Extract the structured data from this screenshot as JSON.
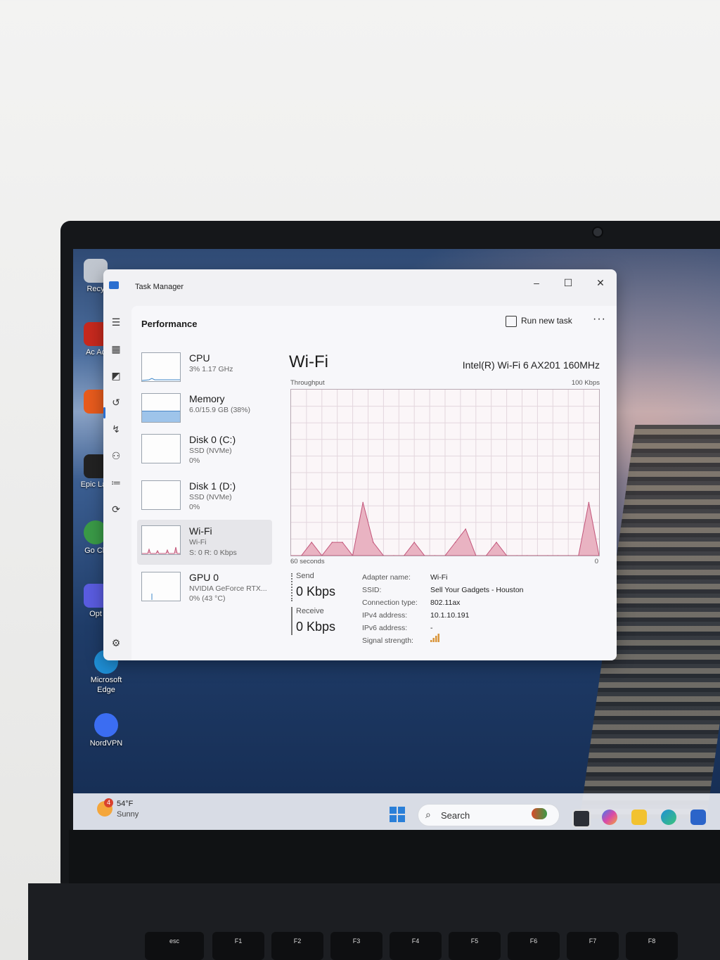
{
  "window": {
    "title": "Task Manager",
    "controls": {
      "minimize": "–",
      "maximize": "☐",
      "close": "✕"
    }
  },
  "page": {
    "heading": "Performance",
    "run_new_task": "Run new task",
    "more": "···"
  },
  "nav_icons": [
    "menu-icon",
    "processes-icon",
    "performance-icon",
    "app-history-icon",
    "startup-apps-icon",
    "users-icon",
    "details-icon",
    "services-icon",
    "settings-icon"
  ],
  "resources": [
    {
      "name": "CPU",
      "line1": "3%  1.17 GHz",
      "line2": ""
    },
    {
      "name": "Memory",
      "line1": "6.0/15.9 GB (38%)",
      "line2": ""
    },
    {
      "name": "Disk 0 (C:)",
      "line1": "SSD (NVMe)",
      "line2": "0%"
    },
    {
      "name": "Disk 1 (D:)",
      "line1": "SSD (NVMe)",
      "line2": "0%"
    },
    {
      "name": "Wi-Fi",
      "line1": "Wi-Fi",
      "line2": "S: 0  R: 0 Kbps"
    },
    {
      "name": "GPU 0",
      "line1": "NVIDIA GeForce RTX...",
      "line2": "0%  (43 °C)"
    }
  ],
  "selected_resource": "Wi-Fi",
  "detail": {
    "title": "Wi-Fi",
    "adapter_model": "Intel(R) Wi-Fi 6 AX201 160MHz",
    "throughput_label": "Throughput",
    "max_label": "100 Kbps",
    "time_label": "60 seconds",
    "zero_label": "0",
    "send_label": "Send",
    "send_value": "0 Kbps",
    "receive_label": "Receive",
    "receive_value": "0 Kbps",
    "info": [
      {
        "key": "Adapter name:",
        "value": "Wi-Fi"
      },
      {
        "key": "SSID:",
        "value": "Sell Your Gadgets - Houston"
      },
      {
        "key": "Connection type:",
        "value": "802.11ax"
      },
      {
        "key": "IPv4 address:",
        "value": "10.1.10.191"
      },
      {
        "key": "IPv6 address:",
        "value": "-"
      },
      {
        "key": "Signal strength:",
        "value": ""
      }
    ]
  },
  "chart_data": {
    "type": "area",
    "ylim": [
      0,
      100
    ],
    "xlim": [
      60,
      0
    ],
    "xlabel": "60 seconds",
    "ylabel": "Throughput",
    "x": [
      60,
      58,
      56,
      54,
      52,
      50,
      48,
      46,
      44,
      42,
      40,
      38,
      36,
      34,
      32,
      30,
      28,
      26,
      24,
      22,
      20,
      18,
      16,
      14,
      12,
      10,
      8,
      6,
      4,
      2,
      0
    ],
    "series": [
      {
        "values": [
          0,
          0,
          8,
          0,
          8,
          8,
          0,
          32,
          8,
          0,
          0,
          0,
          8,
          0,
          0,
          0,
          8,
          16,
          0,
          0,
          8,
          0,
          0,
          0,
          0,
          0,
          0,
          0,
          0,
          32,
          0
        ]
      }
    ]
  },
  "desktop": {
    "icons": [
      {
        "label": "Recy",
        "color": "#c0c6cf"
      },
      {
        "label": "Ac Ac",
        "color": "#c7291e"
      },
      {
        "label": "",
        "color": "#e85b1d"
      },
      {
        "label": "Epic Lau",
        "color": "#222222"
      },
      {
        "label": "Go Ch",
        "color": "#3a9a47"
      },
      {
        "label": "Opt",
        "color": "#5a5ce0"
      },
      {
        "label": "Microsoft Edge",
        "color": "#1f8fd6"
      },
      {
        "label": "NordVPN",
        "color": "#3b6df2"
      }
    ]
  },
  "taskbar": {
    "weather_badge": "4",
    "temperature": "54°F",
    "condition": "Sunny",
    "search_placeholder": "Search",
    "pinned": [
      "widgets-icon",
      "task-view-icon",
      "copilot-icon",
      "file-explorer-icon",
      "edge-icon",
      "store-icon"
    ]
  },
  "keyboard": {
    "keys": [
      "esc",
      "F1",
      "F2",
      "F3",
      "F4",
      "F5",
      "F6",
      "F7",
      "F8"
    ]
  },
  "colors": {
    "accent": "#2b6fd0",
    "wifi_graph_fill": "#e9b3c2",
    "wifi_graph_line": "#c2557a"
  }
}
